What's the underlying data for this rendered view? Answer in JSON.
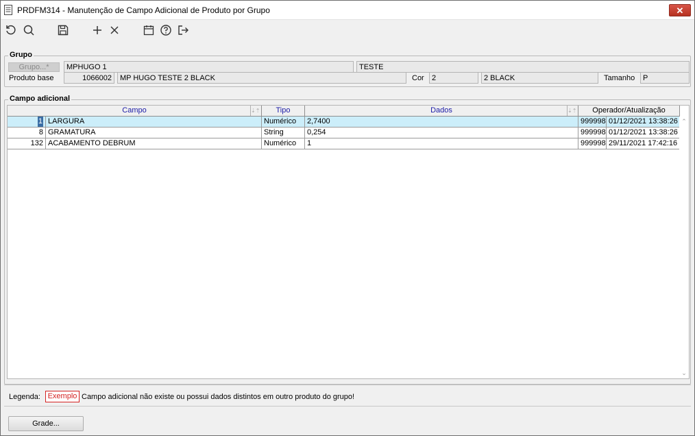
{
  "window": {
    "title": "PRDFM314 - Manutenção de Campo Adicional de Produto por Grupo",
    "close_label": "✕"
  },
  "toolbar": {
    "icons": [
      "refresh-icon",
      "search-icon",
      "save-icon",
      "add-icon",
      "delete-icon",
      "calendar-icon",
      "help-icon",
      "exit-icon"
    ]
  },
  "grupo": {
    "section_title": "Grupo",
    "grupo_button": "Grupo...*",
    "grupo_code": "MPHUGO 1",
    "grupo_desc": "TESTE",
    "produto_base_label": "Produto base",
    "produto_code": "1066002",
    "produto_desc": "MP HUGO TESTE 2 BLACK",
    "cor_label": "Cor",
    "cor_code": "2",
    "cor_desc": "2 BLACK",
    "tamanho_label": "Tamanho",
    "tamanho_value": "P"
  },
  "campo_adicional": {
    "section_title": "Campo adicional",
    "headers": {
      "campo": "Campo",
      "tipo": "Tipo",
      "dados": "Dados",
      "operador": "Operador/Atualização"
    },
    "rows": [
      {
        "id": "1",
        "campo": "LARGURA",
        "tipo": "Numérico",
        "dados": "2,7400",
        "operador": "999998",
        "data": "01/12/2021 13:38:26"
      },
      {
        "id": "8",
        "campo": "GRAMATURA",
        "tipo": "String",
        "dados": "0,254",
        "operador": "999998",
        "data": "01/12/2021 13:38:26"
      },
      {
        "id": "132",
        "campo": "ACABAMENTO DEBRUM",
        "tipo": "Numérico",
        "dados": "1",
        "operador": "999998",
        "data": "29/11/2021 17:42:16"
      }
    ]
  },
  "legenda": {
    "label": "Legenda:",
    "exemplo": "Exemplo",
    "text": "Campo adicional não existe ou possui dados distintos em outro produto do grupo!"
  },
  "bottom": {
    "grade_button": "Grade..."
  },
  "colors": {
    "selected_row": "#cceefa",
    "header_blue": "#1a1aa6",
    "legend_red": "#d42020"
  }
}
